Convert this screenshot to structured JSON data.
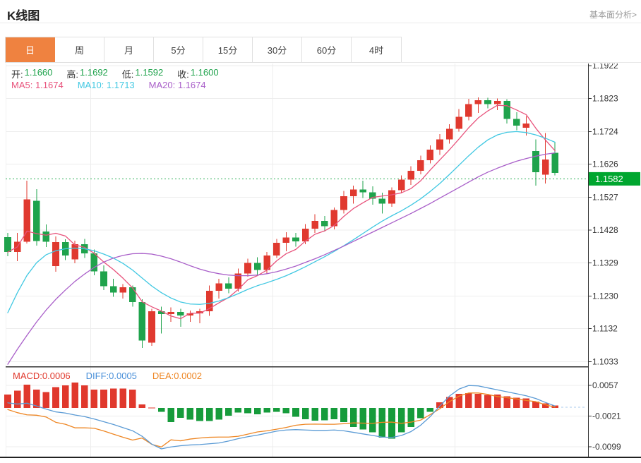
{
  "header": {
    "title": "K线图",
    "link": "基本面分析>"
  },
  "tabs": {
    "items": [
      {
        "label": "日",
        "active": true
      },
      {
        "label": "周",
        "active": false
      },
      {
        "label": "月",
        "active": false
      },
      {
        "label": "5分",
        "active": false
      },
      {
        "label": "15分",
        "active": false
      },
      {
        "label": "30分",
        "active": false
      },
      {
        "label": "60分",
        "active": false
      },
      {
        "label": "4时",
        "active": false
      }
    ]
  },
  "legend": {
    "open_label": "开:",
    "open_value": "1.1660",
    "high_label": "高:",
    "high_value": "1.1692",
    "low_label": "低:",
    "low_value": "1.1592",
    "close_label": "收:",
    "close_value": "1.1600",
    "ma5": "MA5: 1.1674",
    "ma10": "MA10: 1.1713",
    "ma20": "MA20: 1.1674"
  },
  "macd_legend": {
    "macd": "MACD:0.0006",
    "diff": "DIFF:0.0005",
    "dea": "DEA:0.0002"
  },
  "colors": {
    "up": "#E0392F",
    "down": "#1FA34C",
    "ma5": "#E8537C",
    "ma10": "#41C8E2",
    "ma20": "#A95FC9",
    "diff_line": "#5B9BD5",
    "dea_line": "#EE8623",
    "hist_up": "#E0382C",
    "hist_down": "#169B3B",
    "badge_bg": "#00A62F",
    "price_line": "#2FAE57",
    "tab_accent": "#EF8240",
    "grid": "#ededed",
    "axis": "#333333",
    "text_green": "#1FA34C",
    "diff_text": "#4A90D9",
    "dash_cont": "#A9CBEE"
  },
  "chart_data": {
    "type": "candlestick+macd",
    "pane_main": {
      "axis_ticks": [
        "1.1922",
        "1.1823",
        "1.1724",
        "1.1626",
        "1.1527",
        "1.1428",
        "1.1329",
        "1.1230",
        "1.1132",
        "1.1033"
      ],
      "price_line_value": 1.1582,
      "price_badge": "1.1582",
      "candles_format": [
        "open",
        "high",
        "low",
        "close"
      ],
      "candles": [
        [
          1.1407,
          1.142,
          1.135,
          1.1362
        ],
        [
          1.1362,
          1.142,
          1.1335,
          1.1393
        ],
        [
          1.1393,
          1.1576,
          1.1388,
          1.152
        ],
        [
          1.1516,
          1.1551,
          1.1381,
          1.1395
        ],
        [
          1.1424,
          1.1445,
          1.1377,
          1.1393
        ],
        [
          1.132,
          1.1409,
          1.1303,
          1.1392
        ],
        [
          1.1392,
          1.14,
          1.1338,
          1.1352
        ],
        [
          1.134,
          1.1396,
          1.1328,
          1.1386
        ],
        [
          1.1386,
          1.1402,
          1.1344,
          1.1358
        ],
        [
          1.1358,
          1.137,
          1.1292,
          1.1304
        ],
        [
          1.1304,
          1.1322,
          1.1248,
          1.126
        ],
        [
          1.126,
          1.1282,
          1.1228,
          1.124
        ],
        [
          1.124,
          1.1266,
          1.1222,
          1.1256
        ],
        [
          1.1256,
          1.1262,
          1.1198,
          1.1212
        ],
        [
          1.1212,
          1.122,
          1.1074,
          1.1096
        ],
        [
          1.109,
          1.1192,
          1.108,
          1.1184
        ],
        [
          1.1184,
          1.1198,
          1.1118,
          1.1176
        ],
        [
          1.1176,
          1.1196,
          1.1152,
          1.1182
        ],
        [
          1.1182,
          1.1192,
          1.1138,
          1.1172
        ],
        [
          1.1172,
          1.1186,
          1.1152,
          1.1178
        ],
        [
          1.1178,
          1.1192,
          1.1148,
          1.1184
        ],
        [
          1.1184,
          1.1262,
          1.117,
          1.1246
        ],
        [
          1.1246,
          1.1282,
          1.1222,
          1.1268
        ],
        [
          1.1268,
          1.1286,
          1.1238,
          1.1252
        ],
        [
          1.1252,
          1.1312,
          1.1244,
          1.1298
        ],
        [
          1.1298,
          1.1342,
          1.1288,
          1.133
        ],
        [
          1.133,
          1.1346,
          1.1294,
          1.1308
        ],
        [
          1.1308,
          1.1362,
          1.1298,
          1.1352
        ],
        [
          1.1352,
          1.1402,
          1.1344,
          1.139
        ],
        [
          1.139,
          1.1422,
          1.1364,
          1.1406
        ],
        [
          1.1406,
          1.142,
          1.1378,
          1.1394
        ],
        [
          1.1394,
          1.1446,
          1.1386,
          1.1432
        ],
        [
          1.1432,
          1.1476,
          1.142,
          1.1456
        ],
        [
          1.1456,
          1.147,
          1.1424,
          1.144
        ],
        [
          1.144,
          1.1496,
          1.143,
          1.1488
        ],
        [
          1.1488,
          1.1546,
          1.1478,
          1.153
        ],
        [
          1.153,
          1.1562,
          1.1508,
          1.155
        ],
        [
          1.155,
          1.1576,
          1.1524,
          1.1542
        ],
        [
          1.1542,
          1.156,
          1.1504,
          1.1522
        ],
        [
          1.1522,
          1.154,
          1.1478,
          1.1508
        ],
        [
          1.1508,
          1.1556,
          1.1498,
          1.1548
        ],
        [
          1.1548,
          1.1592,
          1.1538,
          1.158
        ],
        [
          1.158,
          1.162,
          1.1564,
          1.1606
        ],
        [
          1.1606,
          1.1652,
          1.1596,
          1.1638
        ],
        [
          1.1638,
          1.1682,
          1.1628,
          1.167
        ],
        [
          1.167,
          1.1716,
          1.1654,
          1.17
        ],
        [
          1.17,
          1.1746,
          1.1688,
          1.1732
        ],
        [
          1.1732,
          1.1792,
          1.1724,
          1.1768
        ],
        [
          1.1768,
          1.1822,
          1.1758,
          1.1806
        ],
        [
          1.1806,
          1.1827,
          1.178,
          1.1818
        ],
        [
          1.1818,
          1.1826,
          1.1794,
          1.1806
        ],
        [
          1.1806,
          1.1823,
          1.1788,
          1.1816
        ],
        [
          1.1816,
          1.1821,
          1.1748,
          1.1762
        ],
        [
          1.1762,
          1.1782,
          1.1728,
          1.1742
        ],
        [
          1.1735,
          1.177,
          1.1712,
          1.1748
        ],
        [
          1.1665,
          1.17,
          1.1562,
          1.1602
        ],
        [
          1.1595,
          1.172,
          1.1568,
          1.164
        ],
        [
          1.166,
          1.1692,
          1.1592,
          1.16
        ]
      ],
      "ma10": [
        1.118,
        1.124,
        1.1292,
        1.133,
        1.1354,
        1.1366,
        1.1372,
        1.1374,
        1.1372,
        1.1366,
        1.1356,
        1.1344,
        1.1328,
        1.1308,
        1.1284,
        1.126,
        1.124,
        1.1224,
        1.1212,
        1.1206,
        1.1205,
        1.1208,
        1.1215,
        1.1225,
        1.1237,
        1.125,
        1.1261,
        1.127,
        1.128,
        1.1291,
        1.1304,
        1.1318,
        1.1333,
        1.1348,
        1.1364,
        1.1381,
        1.1399,
        1.1418,
        1.1437,
        1.1455,
        1.1471,
        1.1486,
        1.1503,
        1.1522,
        1.1544,
        1.1568,
        1.1595,
        1.1623,
        1.1651,
        1.1677,
        1.1699,
        1.1714,
        1.1722,
        1.1724,
        1.1721,
        1.1714,
        1.1704,
        1.1692
      ],
      "ma20": [
        1.1025,
        1.107,
        1.1112,
        1.1152,
        1.1188,
        1.122,
        1.1248,
        1.1274,
        1.1296,
        1.1316,
        1.1332,
        1.1344,
        1.1352,
        1.1357,
        1.1358,
        1.1356,
        1.135,
        1.1342,
        1.1332,
        1.1321,
        1.1311,
        1.1303,
        1.1297,
        1.1293,
        1.1291,
        1.1291,
        1.1293,
        1.1297,
        1.1303,
        1.1311,
        1.132,
        1.1331,
        1.1342,
        1.1354,
        1.1367,
        1.138,
        1.1394,
        1.1408,
        1.1422,
        1.1436,
        1.145,
        1.1464,
        1.1478,
        1.1493,
        1.1508,
        1.1524,
        1.154,
        1.1556,
        1.1572,
        1.1588,
        1.1602,
        1.1614,
        1.1625,
        1.1635,
        1.1643,
        1.165,
        1.1656,
        1.166
      ]
    },
    "pane_macd": {
      "axis_ticks": [
        "0.0057",
        "-0.0021",
        "-0.0099"
      ],
      "hist": [
        0.0034,
        0.0044,
        0.0059,
        0.0047,
        0.004,
        0.0053,
        0.0057,
        0.0065,
        0.0057,
        0.0047,
        0.0047,
        0.0049,
        0.0049,
        0.0047,
        0.0009,
        0.0001,
        -0.001,
        -0.0036,
        -0.0025,
        -0.003,
        -0.0033,
        -0.0033,
        -0.003,
        -0.002,
        -0.0012,
        -0.0013,
        -0.0016,
        -0.0012,
        -0.001,
        -0.0013,
        -0.0022,
        -0.0029,
        -0.0032,
        -0.0031,
        -0.0029,
        -0.0036,
        -0.0048,
        -0.0055,
        -0.0062,
        -0.0075,
        -0.0078,
        -0.0062,
        -0.0048,
        -0.0026,
        -0.001,
        0.0014,
        0.0028,
        0.0036,
        0.0038,
        0.0036,
        0.0033,
        0.0034,
        0.003,
        0.0026,
        0.0024,
        0.0016,
        0.0012,
        0.0006
      ],
      "diff": [
        0.0013,
        0.001,
        0.0012,
        0.0005,
        -0.0003,
        -0.001,
        -0.0013,
        -0.0018,
        -0.0022,
        -0.0028,
        -0.0035,
        -0.0042,
        -0.005,
        -0.0058,
        -0.0072,
        -0.0092,
        -0.0104,
        -0.0099,
        -0.0096,
        -0.0094,
        -0.0093,
        -0.0091,
        -0.0089,
        -0.0084,
        -0.0078,
        -0.0073,
        -0.0069,
        -0.0064,
        -0.0059,
        -0.0056,
        -0.0055,
        -0.0056,
        -0.0057,
        -0.0057,
        -0.0056,
        -0.0058,
        -0.0062,
        -0.0066,
        -0.007,
        -0.0074,
        -0.0075,
        -0.007,
        -0.006,
        -0.0044,
        -0.0022,
        0.0005,
        0.003,
        0.0048,
        0.0057,
        0.0056,
        0.0051,
        0.0046,
        0.0041,
        0.0036,
        0.0031,
        0.0024,
        0.0014,
        0.0005
      ]
    }
  }
}
